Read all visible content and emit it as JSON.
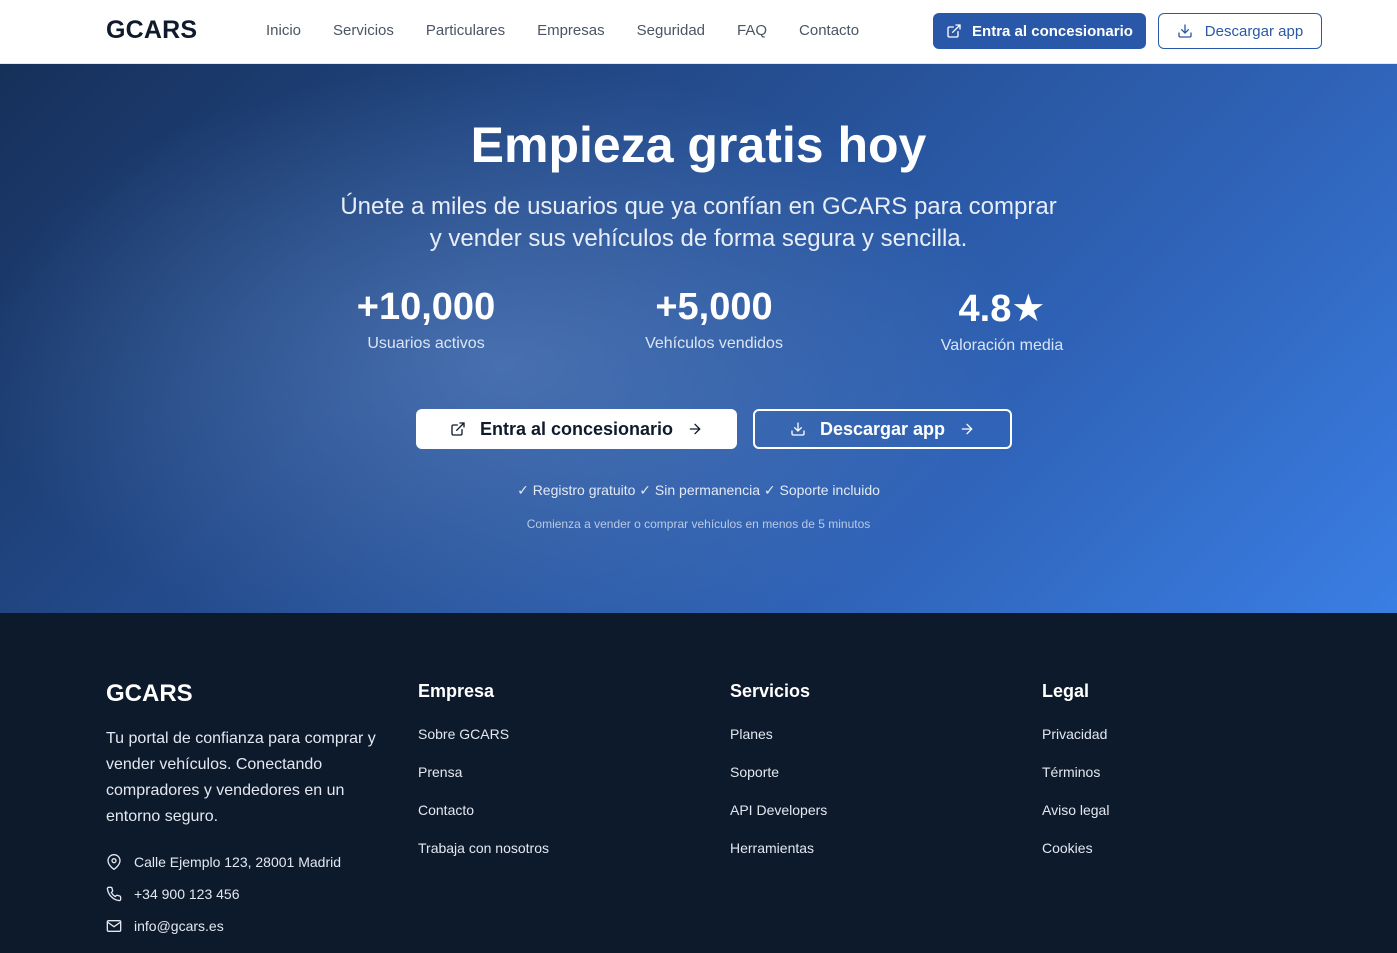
{
  "header": {
    "logo": "GCARS",
    "nav": [
      "Inicio",
      "Servicios",
      "Particulares",
      "Empresas",
      "Seguridad",
      "FAQ",
      "Contacto"
    ],
    "primary_button": "Entra al concesionario",
    "outline_button": "Descargar app"
  },
  "hero": {
    "title": "Empieza gratis hoy",
    "subtitle_line1": "Únete a miles de usuarios que ya confían en GCARS para comprar",
    "subtitle_line2": "y vender sus vehículos de forma segura y sencilla.",
    "stats": [
      {
        "value": "+10,000",
        "label": "Usuarios activos"
      },
      {
        "value": "+5,000",
        "label": "Vehículos vendidos"
      },
      {
        "value": "4.8★",
        "label": "Valoración media"
      }
    ],
    "cta_primary": "Entra al concesionario",
    "cta_secondary": "Descargar app",
    "checks": "✓ Registro gratuito ✓ Sin permanencia ✓ Soporte incluido",
    "note": "Comienza a vender o comprar vehículos en menos de 5 minutos"
  },
  "footer": {
    "logo": "GCARS",
    "description": "Tu portal de confianza para comprar y vender vehículos. Conectando compradores y vendedores en un entorno seguro.",
    "address": "Calle Ejemplo 123, 28001 Madrid",
    "phone": "+34 900 123 456",
    "email": "info@gcars.es",
    "columns": [
      {
        "title": "Empresa",
        "links": [
          "Sobre GCARS",
          "Prensa",
          "Contacto",
          "Trabaja con nosotros"
        ]
      },
      {
        "title": "Servicios",
        "links": [
          "Planes",
          "Soporte",
          "API Developers",
          "Herramientas"
        ]
      },
      {
        "title": "Legal",
        "links": [
          "Privacidad",
          "Términos",
          "Aviso legal",
          "Cookies"
        ]
      }
    ]
  },
  "colors": {
    "brand_blue": "#2a58a8",
    "footer_bg": "#0d1a2c",
    "logo_dark": "#0f1b2d"
  }
}
